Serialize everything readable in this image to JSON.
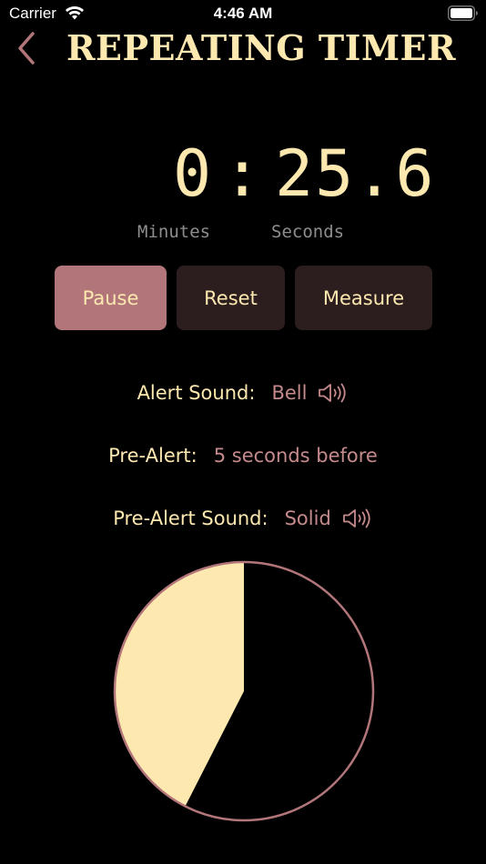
{
  "status_bar": {
    "carrier": "Carrier",
    "time": "4:46 AM",
    "wifi_icon": "wifi-icon",
    "battery_icon": "battery-full-icon"
  },
  "nav": {
    "back_icon": "chevron-left-icon",
    "title": "REPEATING TIMER"
  },
  "timer": {
    "minutes": "0",
    "colon": ":",
    "seconds": "25.6",
    "minutes_label": "Minutes",
    "seconds_label": "Seconds"
  },
  "buttons": {
    "pause": "Pause",
    "reset": "Reset",
    "measure": "Measure"
  },
  "settings": {
    "alert_sound_label": "Alert Sound:",
    "alert_sound_value": "Bell",
    "pre_alert_label": "Pre-Alert:",
    "pre_alert_value": "5 seconds before",
    "pre_alert_sound_label": "Pre-Alert Sound:",
    "pre_alert_sound_value": "Solid",
    "speaker_icon": "speaker-wave-icon"
  },
  "progress": {
    "elapsed_fraction": 0.425,
    "fill_color": "#fde8b0",
    "ring_color": "#b2767a"
  },
  "colors": {
    "accent": "#fde8b0",
    "brand_rose": "#b2767a",
    "value_text": "#c48a8c",
    "button_dark": "#2c1e1e"
  }
}
